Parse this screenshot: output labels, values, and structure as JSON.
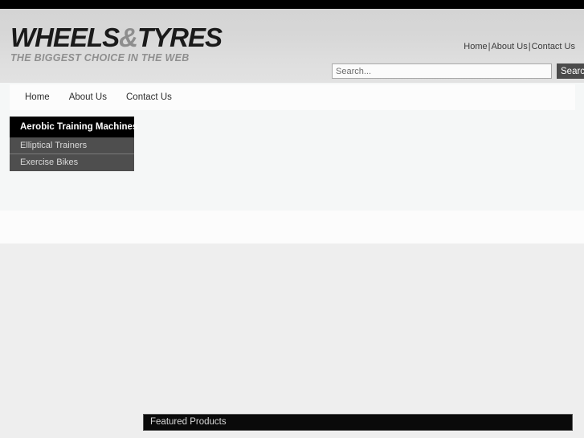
{
  "site": {
    "logo_main_before": "WHEELS",
    "logo_amp": "&",
    "logo_main_after": "TYRES",
    "tagline": "THE BIGGEST CHOICE IN THE WEB"
  },
  "top_links": {
    "home": "Home",
    "sep1": "|",
    "about": "About Us",
    "sep2": "|",
    "contact": "Contact Us"
  },
  "search": {
    "placeholder": "Search...",
    "value": "",
    "button_label": "Search"
  },
  "nav": {
    "items": [
      {
        "label": "Home"
      },
      {
        "label": "About Us"
      },
      {
        "label": "Contact Us"
      }
    ]
  },
  "sidebar": {
    "title": "Aerobic Training Machines",
    "items": [
      {
        "label": "Elliptical Trainers"
      },
      {
        "label": "Exercise Bikes"
      }
    ]
  },
  "featured": {
    "title": "Featured Products"
  },
  "colors": {
    "top_strip": "#000000",
    "header_gradient_start": "#d4d4d4",
    "header_gradient_end": "#e2e2e2",
    "nav_background": "#fcfcfc",
    "sidebar_title_background": "#000000",
    "sidebar_item_background": "#4e4e4e",
    "search_button_background": "#4b4b4b",
    "featured_bar_background": "#0a0a0a",
    "page_background": "#f5f7f7",
    "gray_band": "#eeeeee"
  }
}
